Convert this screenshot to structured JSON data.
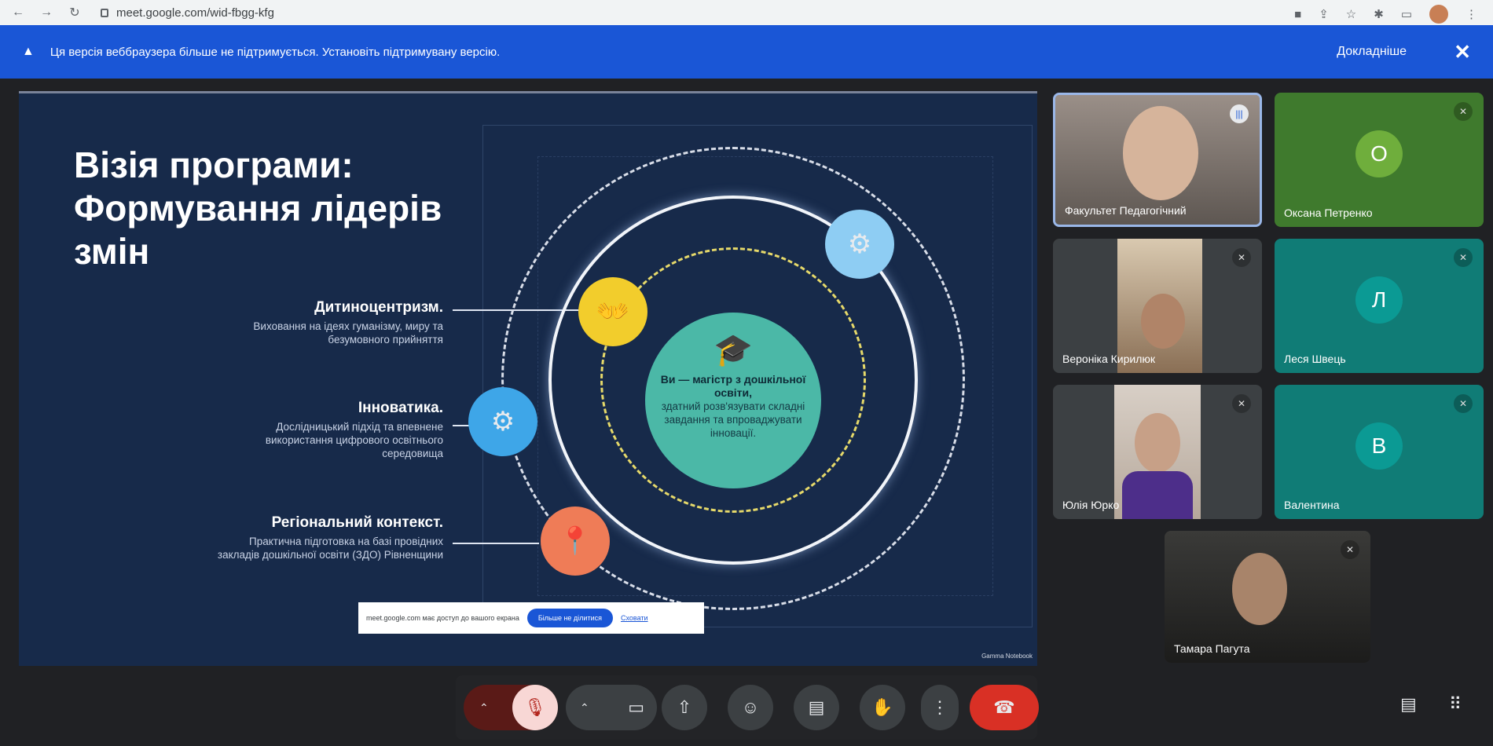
{
  "browser": {
    "url": "meet.google.com/wid-fbgg-kfg"
  },
  "banner": {
    "text": "Ця версія веббраузера більше не підтримується. Установіть підтримувану версію.",
    "more": "Докладніше",
    "close": "✕"
  },
  "slide": {
    "title": "Візія програми: Формування лідерів змін",
    "bullets": [
      {
        "heading": "Дитиноцентризм.",
        "text": "Виховання на ідеях гуманізму, миру та безумовного прийняття"
      },
      {
        "heading": "Інноватика.",
        "text": "Дослідницький підхід та впевнене використання цифрового освітнього середовища"
      },
      {
        "heading": "Регіональний контекст.",
        "text": "Практична підготовка на базі провідних закладів дошкільної освіти (ЗДО) Рівненщини"
      }
    ],
    "center_bold": "Ви — магістр з дошкільної освіти,",
    "center_text": "здатний розв'язувати складні завдання та впроваджувати інновації.",
    "watermark": "Gamma Notebook"
  },
  "share_popup": {
    "text": "meet.google.com має доступ до вашого екрана",
    "stop": "Більше не ділитися",
    "hide": "Сховати"
  },
  "participants": [
    {
      "name": "Факультет Педагогічний",
      "type": "video",
      "speaking": true
    },
    {
      "name": "Оксана Петренко",
      "type": "letter",
      "letter": "О",
      "bg": "#3f7a2d",
      "circle": "#6fae3c"
    },
    {
      "name": "Вероніка Кирилюк",
      "type": "video"
    },
    {
      "name": "Леся Швець",
      "type": "letter",
      "letter": "Л",
      "bg": "#107c76",
      "circle": "#0b9a94"
    },
    {
      "name": "Юлія Юрко",
      "type": "video"
    },
    {
      "name": "Валентина",
      "type": "letter",
      "letter": "В",
      "bg": "#107c76",
      "circle": "#0b9a94"
    },
    {
      "name": "Тамара Пагута",
      "type": "video"
    }
  ],
  "colors": {
    "banner": "#1a56d6",
    "slide_bg": "#172a4a",
    "end_call": "#d93025",
    "mic_off": "#f8d7d5"
  }
}
